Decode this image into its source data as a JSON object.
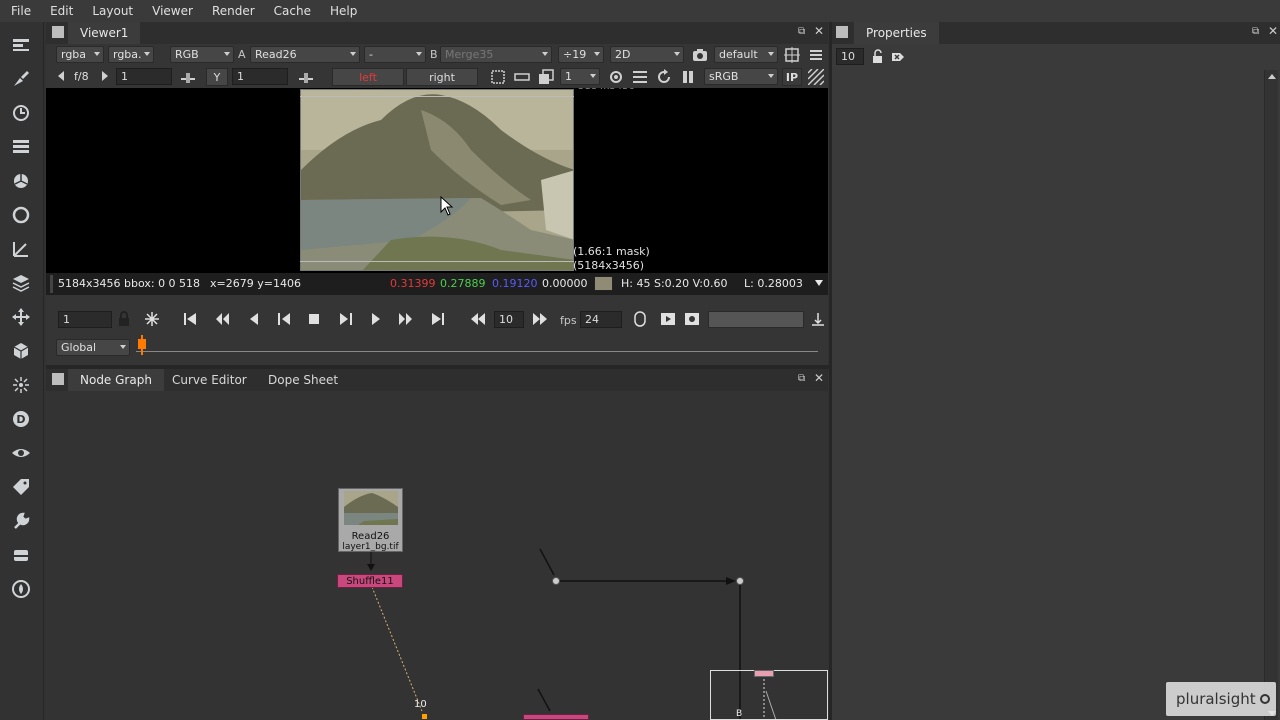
{
  "menu": [
    "File",
    "Edit",
    "Layout",
    "Viewer",
    "Render",
    "Cache",
    "Help"
  ],
  "viewer": {
    "tab_label": "Viewer1",
    "channels_a": "rgba",
    "channels_b": "rgba.",
    "display_channels": "RGB",
    "input_a_label": "A",
    "input_a": "Read26",
    "input_ab_mode": "-",
    "input_b_label": "B",
    "input_b": "Merge35",
    "downrez": "÷19",
    "view_mode": "2D",
    "lut_default": "default",
    "fstop": "f/8",
    "gain": "1",
    "gamma_label": "Y",
    "gamma": "1",
    "stereo_left": "left",
    "stereo_right": "right",
    "proxy": "1",
    "colorspace": "sRGB",
    "ip_label": "IP",
    "image_format_top": "5184x3456",
    "mask_label": "(1.66:1 mask)",
    "mask_size": "(5184x3456)"
  },
  "infobar": {
    "format": "5184x3456 bbox: 0 0 518",
    "coords": "x=2679 y=1406",
    "r": "0.31399",
    "g": "0.27889",
    "b": "0.19120",
    "a": "0.00000",
    "hsv": "H: 45 S:0.20 V:0.60",
    "luma": "L: 0.28003",
    "swatch_color": "#8f8b74"
  },
  "timeline": {
    "frame": "1",
    "step": "10",
    "fps_label": "fps",
    "fps": "24",
    "range_mode": "Global"
  },
  "nodegraph_tabs": [
    "Node Graph",
    "Curve Editor",
    "Dope Sheet"
  ],
  "nodes": {
    "read_name": "Read26",
    "read_file": "layer1_bg.tif",
    "shuffle_name": "Shuffle11",
    "expression_label": "10",
    "merge_input_label": "B"
  },
  "properties": {
    "tab_label": "Properties",
    "max_panels": "10"
  },
  "watermark": "pluralsight",
  "colors": {
    "accent_red": "#e23a3a",
    "accent_green": "#4ccf4c",
    "accent_blue": "#5a5aff",
    "node_pink": "#c8487e",
    "frame_marker": "#ff7a00"
  }
}
